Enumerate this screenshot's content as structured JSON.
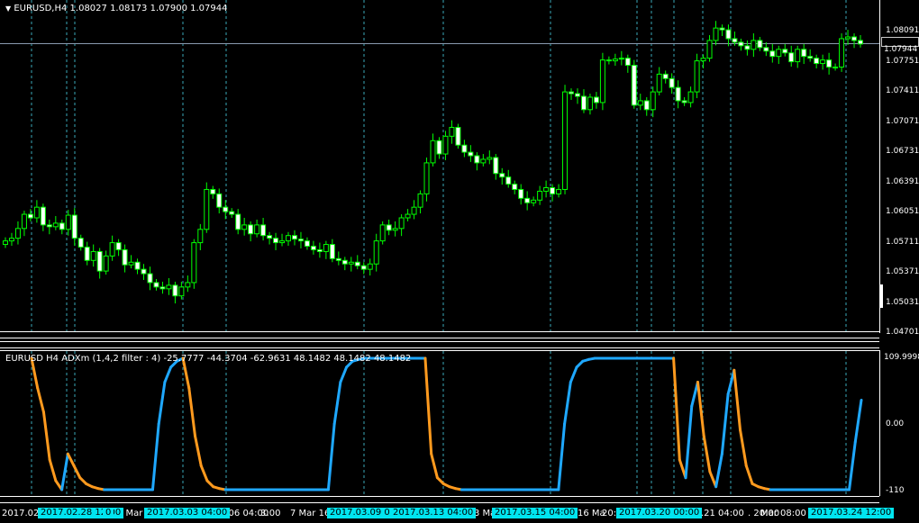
{
  "main_chart": {
    "title": "EURUSD,H4  1.08027 1.08173 1.07900 1.07944",
    "current_price": "1.07944",
    "price_axis": [
      "1.08091",
      "1.07751",
      "1.07411",
      "1.07071",
      "1.06731",
      "1.06391",
      "1.06051",
      "1.05711",
      "1.05371",
      "1.05031",
      "1.04701"
    ]
  },
  "indicator": {
    "title": "EURUSD H4 ADXm (1,4,2 filter : 4) -25.7777 -44.3704 -62.9631 48.1482 48.1482 48.1482",
    "axis": [
      "109.9998",
      "0.00",
      "-110"
    ]
  },
  "time_axis": {
    "labels": [
      "2017.02.",
      "1 Mar 1",
      "3.06 04:00",
      "3:00",
      "7 Mar 16:",
      "3 Mar",
      "16 Ma",
      "20:",
      ".03.21 04:00",
      ". 20:00",
      "Mar 08:00"
    ],
    "cursor_tags": [
      "2017.02.28 12:00",
      "0",
      "2017.03.03 04:00",
      "2017.03.09 08:00",
      "2017.03.13 04:00",
      "2017.03.15 04:00",
      "2017.03.20 00:00",
      "2017.03.24 12:00"
    ]
  },
  "colors": {
    "bull": "#00ff00",
    "bear_body": "#ffffff",
    "grid_vline": "#3aa8b8",
    "adx_up": "#1fa8ff",
    "adx_down": "#ff9a1e",
    "tag_bg": "#00e5f0"
  },
  "candles": {
    "closes": [
      1.0572,
      1.0575,
      1.0586,
      1.0602,
      1.0598,
      1.061,
      1.059,
      1.0588,
      1.0592,
      1.0585,
      1.0601,
      1.0575,
      1.0565,
      1.055,
      1.056,
      1.0538,
      1.0555,
      1.057,
      1.0562,
      1.0545,
      1.0548,
      1.054,
      1.0535,
      1.0525,
      1.052,
      1.0518,
      1.0522,
      1.051,
      1.052,
      1.0525,
      1.057,
      1.0585,
      1.063,
      1.0625,
      1.061,
      1.0605,
      1.0602,
      1.0585,
      1.059,
      1.058,
      1.059,
      1.0578,
      1.0575,
      1.057,
      1.0572,
      1.0578,
      1.0574,
      1.0572,
      1.0566,
      1.0562,
      1.056,
      1.0568,
      1.0552,
      1.055,
      1.0546,
      1.0548,
      1.0544,
      1.054,
      1.0546,
      1.0572,
      1.059,
      1.0584,
      1.0586,
      1.0598,
      1.0602,
      1.061,
      1.0625,
      1.066,
      1.0685,
      1.067,
      1.069,
      1.07,
      1.068,
      1.0672,
      1.0668,
      1.066,
      1.0664,
      1.0666,
      1.0648,
      1.0644,
      1.0636,
      1.063,
      1.062,
      1.0615,
      1.0618,
      1.0628,
      1.0632,
      1.0625,
      1.063,
      1.074,
      1.0738,
      1.0735,
      1.072,
      1.0734,
      1.0728,
      1.0776,
      1.0775,
      1.0777,
      1.0778,
      1.077,
      1.0725,
      1.073,
      1.072,
      1.074,
      1.076,
      1.0755,
      1.0745,
      1.073,
      1.0728,
      1.074,
      1.0775,
      1.0778,
      1.0798,
      1.0812,
      1.081,
      1.08,
      1.0796,
      1.0792,
      1.0788,
      1.0798,
      1.079,
      1.0786,
      1.078,
      1.0788,
      1.0784,
      1.0774,
      1.0788,
      1.078,
      1.0778,
      1.0772,
      1.0776,
      1.0768,
      1.0768,
      1.08,
      1.0802,
      1.0798,
      1.0794
    ]
  },
  "adx": {
    "values": [
      110,
      60,
      20,
      -60,
      -95,
      -110,
      -50,
      -70,
      -90,
      -100,
      -105,
      -108,
      -110,
      -110,
      -110,
      -110,
      -110,
      -110,
      -110,
      -110,
      -110,
      0,
      70,
      95,
      105,
      110,
      60,
      -20,
      -70,
      -95,
      -105,
      -108,
      -110,
      -110,
      -110,
      -110,
      -110,
      -110,
      -110,
      -110,
      -110,
      -110,
      -110,
      -110,
      -110,
      -110,
      -110,
      -110,
      -110,
      -110,
      0,
      70,
      95,
      105,
      108,
      110,
      110,
      110,
      110,
      110,
      110,
      110,
      110,
      110,
      110,
      110,
      -50,
      -90,
      -100,
      -105,
      -108,
      -110,
      -110,
      -110,
      -110,
      -110,
      -110,
      -110,
      -110,
      -110,
      -110,
      -110,
      -110,
      -110,
      -110,
      -110,
      -110,
      -110,
      0,
      70,
      95,
      105,
      108,
      110,
      110,
      110,
      110,
      110,
      110,
      110,
      110,
      110,
      110,
      110,
      110,
      110,
      110,
      -60,
      -90,
      30,
      70,
      -20,
      -80,
      -105,
      -50,
      50,
      90,
      -10,
      -70,
      -100,
      -105,
      -108,
      -110,
      -110,
      -110,
      -110,
      -110,
      -110,
      -110,
      -110,
      -110,
      -110,
      -110,
      -110,
      -110,
      -110,
      -30,
      40
    ]
  }
}
